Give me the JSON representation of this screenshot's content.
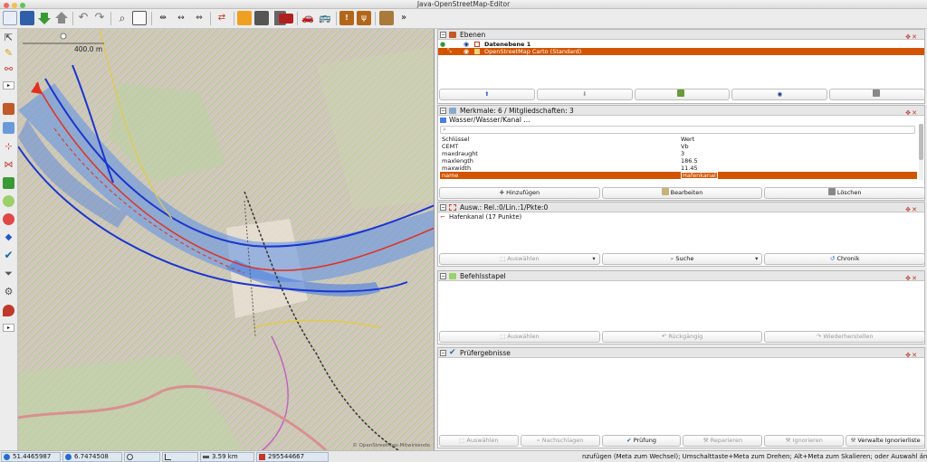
{
  "window": {
    "title": "Java-OpenStreetMap-Editor"
  },
  "toolbar": {
    "icons": [
      "new-icon",
      "save-icon",
      "download-icon",
      "upload-icon",
      "undo-icon",
      "redo-icon",
      "zoom-icon",
      "zoom-selection-icon",
      "split-icon",
      "combine-icon",
      "align-icon",
      "reverse-icon",
      "parking-icon",
      "road-icon",
      "building-icon",
      "car-icon",
      "bus-icon",
      "warning-icon",
      "restaurant-icon",
      "industrial-icon"
    ]
  },
  "map": {
    "scale_label": "400.0 m",
    "attribution": "© OpenStreetMap-Mitwirkende"
  },
  "layers_panel": {
    "title": "Ebenen",
    "layers": [
      {
        "name": "Datenebene 1",
        "active": true
      },
      {
        "name": "OpenStreetMap Carto (Standard)",
        "active": false
      }
    ]
  },
  "tags_panel": {
    "title": "Merkmale: 6 / Mitgliedschaften: 3",
    "object": "Wasser/Wasser/Kanal ...",
    "col_key": "Schlüssel",
    "col_value": "Wert",
    "rows": [
      {
        "key": "CEMT",
        "value": "Vb"
      },
      {
        "key": "maxdraught",
        "value": "3"
      },
      {
        "key": "maxlength",
        "value": "186.5"
      },
      {
        "key": "maxwidth",
        "value": "11.45"
      },
      {
        "key": "name",
        "value": "Hafenkanal"
      }
    ],
    "buttons": {
      "add": "Hinzufügen",
      "edit": "Bearbeiten",
      "delete": "Löschen"
    }
  },
  "selection_panel": {
    "title": "Ausw.: Rel.:0/Lin.:1/Pkte:0",
    "item": "Hafenkanal (17 Punkte)",
    "buttons": {
      "select": "Auswählen",
      "search": "Suche",
      "history": "Chronik"
    }
  },
  "command_panel": {
    "title": "Befehlsstapel",
    "buttons": {
      "select": "Auswählen",
      "undo": "Rückgängig",
      "redo": "Wiederherstellen"
    }
  },
  "validator_panel": {
    "title": "Prüfergebnisse",
    "buttons": {
      "select": "Auswählen",
      "lookup": "Nachschlagen",
      "validate": "Prüfung",
      "fix": "Reparieren",
      "ignore": "Ignorieren",
      "manage": "Verwalte Ignorierliste"
    }
  },
  "status": {
    "lat": "51.4465987",
    "lon": "6.7474508",
    "distance": "3.59 km",
    "way_id": "295544667",
    "hint": "nzufügen (Meta zum Wechsel); Umschalttaste+Meta zum Drehen; Alt+Meta zum Skalieren; oder Auswahl ändern"
  },
  "colors": {
    "selection": "#d35400",
    "water_fill": "#4a7fe0",
    "way_red": "#e03020",
    "way_blue": "#1a35d0"
  }
}
